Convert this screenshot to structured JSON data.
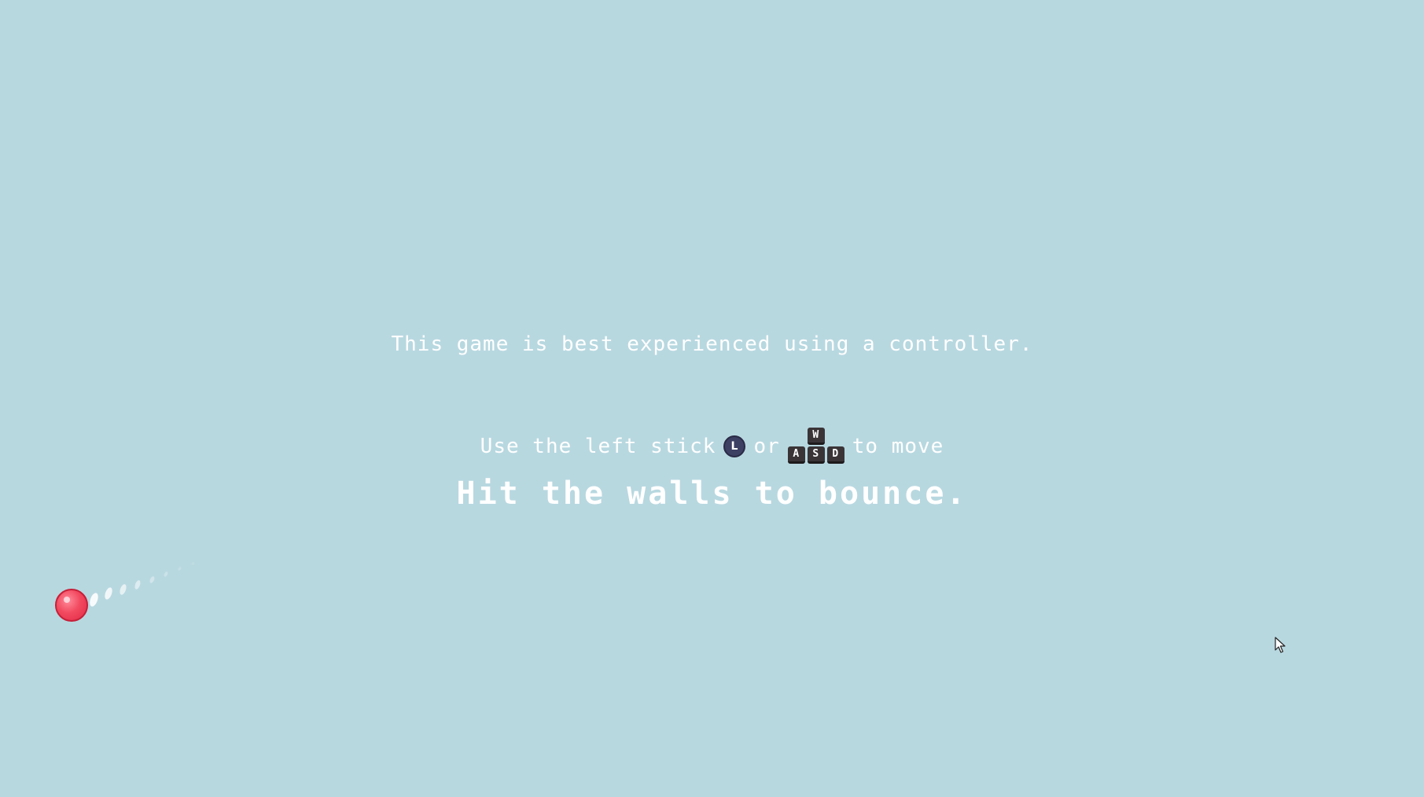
{
  "colors": {
    "background": "#b8d8e0",
    "text": "#ffffff",
    "ball": "#f24a60",
    "stick_icon": "#3d3f63",
    "key_icon": "#3a3437"
  },
  "hints": {
    "controller": "This game is best experienced using a controller.",
    "move_prefix": "Use the left stick",
    "move_or": "or",
    "move_suffix": "to move",
    "bounce": "Hit the walls to bounce."
  },
  "icons": {
    "stick": {
      "name": "left-stick-icon",
      "letter": "L"
    },
    "keys": {
      "name": "wasd-keys-icon",
      "w": "W",
      "a": "A",
      "s": "S",
      "d": "D"
    }
  },
  "player": {
    "name": "player-ball"
  },
  "cursor": {
    "name": "mouse-cursor-icon"
  }
}
